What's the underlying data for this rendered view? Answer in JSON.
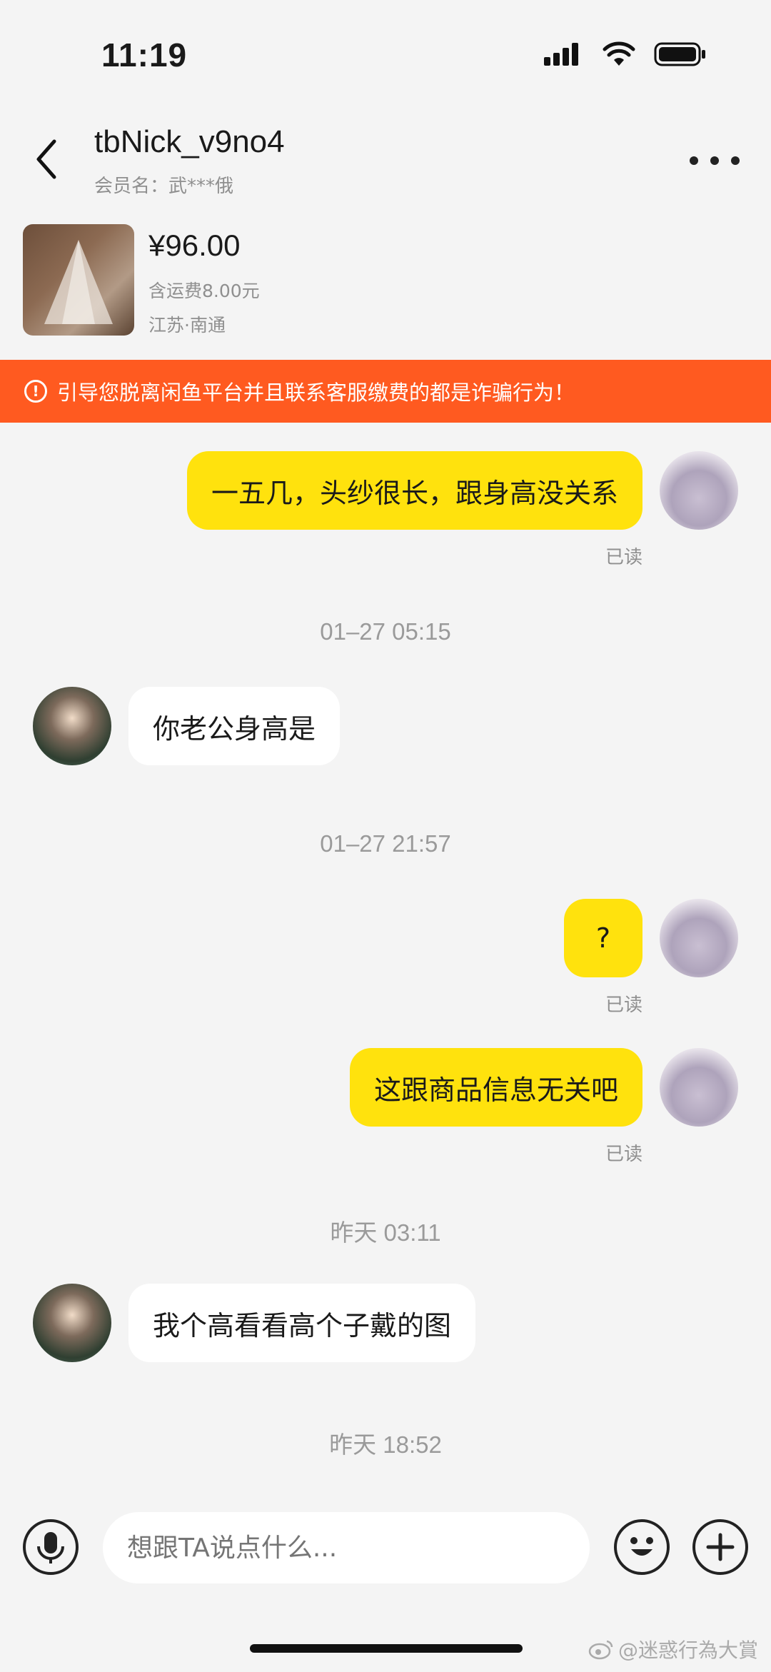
{
  "status_bar": {
    "time": "11:19"
  },
  "header": {
    "nickname": "tbNick_v9no4",
    "member_name": "会员名：武***俄"
  },
  "product": {
    "price": "¥96.00",
    "shipping": "含运费8.00元",
    "location": "江苏·南通"
  },
  "warning": {
    "icon": "!",
    "text": "引导您脱离闲鱼平台并且联系客服缴费的都是诈骗行为！"
  },
  "messages": [
    {
      "sender": "me",
      "text": "一五几，头纱很长，跟身高没关系",
      "status": "已读"
    },
    {
      "timestamp": "01–27 05:15"
    },
    {
      "sender": "them",
      "text": "你老公身高是"
    },
    {
      "timestamp": "01–27 21:57"
    },
    {
      "sender": "me",
      "text": "?",
      "status": "已读"
    },
    {
      "sender": "me",
      "text": "这跟商品信息无关吧",
      "status": "已读"
    },
    {
      "timestamp": "昨天 03:11"
    },
    {
      "sender": "them",
      "text": "我个高看看高个子戴的图"
    },
    {
      "timestamp": "昨天 18:52"
    }
  ],
  "input": {
    "placeholder": "想跟TA说点什么..."
  },
  "watermark": "@迷惑行為大賞",
  "colors": {
    "accent_yellow": "#ffe20d",
    "warning_orange": "#ff5a20",
    "background": "#f4f4f4"
  }
}
